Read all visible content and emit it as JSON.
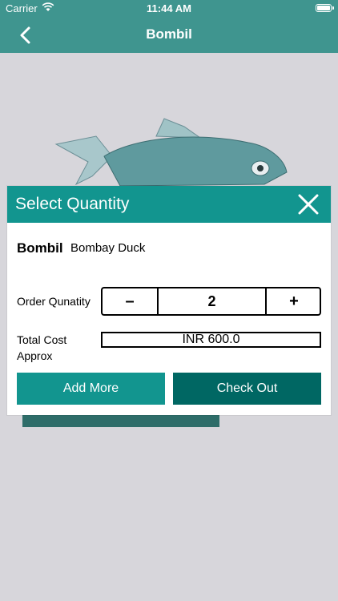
{
  "status_bar": {
    "carrier": "Carrier",
    "time": "11:44 AM"
  },
  "nav": {
    "title": "Bombil"
  },
  "dialog": {
    "title": "Select Quantity",
    "product_name": "Bombil",
    "product_alt_name": "Bombay Duck",
    "order_label": "Order Qunatity",
    "minus_label": "–",
    "quantity": "2",
    "plus_label": "+",
    "total_label": "Total Cost Approx",
    "total_value": "INR 600.0",
    "add_more_label": "Add More",
    "checkout_label": "Check Out"
  },
  "colors": {
    "primary": "#12958f",
    "dark": "#006763",
    "nav": "#3f958f"
  },
  "icons": {
    "back": "chevron-left-icon",
    "close": "close-icon",
    "wifi": "wifi-icon",
    "battery": "battery-icon"
  }
}
